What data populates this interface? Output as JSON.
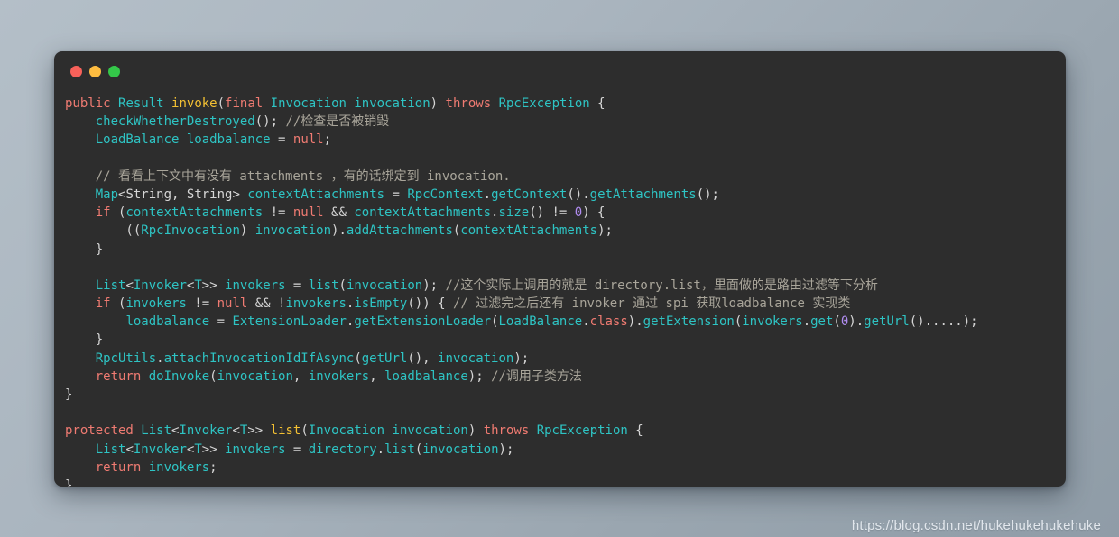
{
  "window": {
    "title": "",
    "controls": [
      {
        "name": "close-button",
        "color": "#f8615a"
      },
      {
        "name": "minimize-button",
        "color": "#fdbc40"
      },
      {
        "name": "maximize-button",
        "color": "#34c749"
      }
    ]
  },
  "theme": {
    "background_gradient_start": "#b4bfc8",
    "background_gradient_end": "#8f9ca7",
    "editor_background": "#2d2d2d",
    "keyword": "#f07b72",
    "type": "#2ec4c4",
    "function_declaration": "#f3c033",
    "punctuation": "#d6d6d6",
    "number": "#b08cf0",
    "comment": "#a9a59a"
  },
  "watermark": {
    "text": "https://blog.csdn.net/hukehukehukehuke"
  },
  "code": {
    "language": "java",
    "lines": [
      "public Result invoke(final Invocation invocation) throws RpcException {",
      "    checkWhetherDestroyed(); //检查是否被销毁",
      "    LoadBalance loadbalance = null;",
      "",
      "    // 看看上下文中有没有 attachments ，有的话绑定到 invocation.",
      "    Map<String, String> contextAttachments = RpcContext.getContext().getAttachments();",
      "    if (contextAttachments != null && contextAttachments.size() != 0) {",
      "        ((RpcInvocation) invocation).addAttachments(contextAttachments);",
      "    }",
      "",
      "    List<Invoker<T>> invokers = list(invocation); //这个实际上调用的就是 directory.list，里面做的是路由过滤等下分析",
      "    if (invokers != null && !invokers.isEmpty()) { // 过滤完之后还有 invoker 通过 spi 获取loadbalance 实现类",
      "        loadbalance = ExtensionLoader.getExtensionLoader(LoadBalance.class).getExtension(invokers.get(0).getUrl().....);",
      "    }",
      "    RpcUtils.attachInvocationIdIfAsync(getUrl(), invocation);",
      "    return doInvoke(invocation, invokers, loadbalance); //调用子类方法",
      "}",
      "",
      "protected List<Invoker<T>> list(Invocation invocation) throws RpcException {",
      "    List<Invoker<T>> invokers = directory.list(invocation);",
      "    return invokers;",
      "}"
    ],
    "tokens": [
      [
        [
          "public",
          "kw"
        ],
        [
          " ",
          "pun"
        ],
        [
          "Result",
          "typ"
        ],
        [
          " ",
          "pun"
        ],
        [
          "invoke",
          "fn"
        ],
        [
          "(",
          "pun"
        ],
        [
          "final",
          "kw"
        ],
        [
          " ",
          "pun"
        ],
        [
          "Invocation",
          "typ"
        ],
        [
          " ",
          "pun"
        ],
        [
          "invocation",
          "typ"
        ],
        [
          ")",
          "pun"
        ],
        [
          " ",
          "pun"
        ],
        [
          "throws",
          "kw"
        ],
        [
          " ",
          "pun"
        ],
        [
          "RpcException",
          "typ"
        ],
        [
          " {",
          "pun"
        ]
      ],
      [
        [
          "    ",
          "pun"
        ],
        [
          "checkWhetherDestroyed",
          "call"
        ],
        [
          "(); ",
          "pun"
        ],
        [
          "//检查是否被销毁",
          "cmt"
        ]
      ],
      [
        [
          "    ",
          "pun"
        ],
        [
          "LoadBalance",
          "typ"
        ],
        [
          " ",
          "pun"
        ],
        [
          "loadbalance",
          "typ"
        ],
        [
          " = ",
          "pun"
        ],
        [
          "null",
          "kw"
        ],
        [
          ";",
          "pun"
        ]
      ],
      [
        [
          "",
          "pun"
        ]
      ],
      [
        [
          "    ",
          "pun"
        ],
        [
          "// 看看上下文中有没有 attachments ，有的话绑定到 invocation.",
          "cmt"
        ]
      ],
      [
        [
          "    ",
          "pun"
        ],
        [
          "Map",
          "typ"
        ],
        [
          "<",
          "pun"
        ],
        [
          "String",
          "pun"
        ],
        [
          ", ",
          "pun"
        ],
        [
          "String",
          "pun"
        ],
        [
          "> ",
          "pun"
        ],
        [
          "contextAttachments",
          "typ"
        ],
        [
          " = ",
          "pun"
        ],
        [
          "RpcContext",
          "typ"
        ],
        [
          ".",
          "pun"
        ],
        [
          "getContext",
          "call"
        ],
        [
          "().",
          "pun"
        ],
        [
          "getAttachments",
          "call"
        ],
        [
          "();",
          "pun"
        ]
      ],
      [
        [
          "    ",
          "pun"
        ],
        [
          "if",
          "kw"
        ],
        [
          " (",
          "pun"
        ],
        [
          "contextAttachments",
          "typ"
        ],
        [
          " != ",
          "pun"
        ],
        [
          "null",
          "kw"
        ],
        [
          " && ",
          "pun"
        ],
        [
          "contextAttachments",
          "typ"
        ],
        [
          ".",
          "pun"
        ],
        [
          "size",
          "call"
        ],
        [
          "() != ",
          "pun"
        ],
        [
          "0",
          "num"
        ],
        [
          ") {",
          "pun"
        ]
      ],
      [
        [
          "        ((",
          "pun"
        ],
        [
          "RpcInvocation",
          "typ"
        ],
        [
          ") ",
          "pun"
        ],
        [
          "invocation",
          "typ"
        ],
        [
          ").",
          "pun"
        ],
        [
          "addAttachments",
          "call"
        ],
        [
          "(",
          "pun"
        ],
        [
          "contextAttachments",
          "typ"
        ],
        [
          ");",
          "pun"
        ]
      ],
      [
        [
          "    }",
          "pun"
        ]
      ],
      [
        [
          "",
          "pun"
        ]
      ],
      [
        [
          "    ",
          "pun"
        ],
        [
          "List",
          "typ"
        ],
        [
          "<",
          "pun"
        ],
        [
          "Invoker",
          "typ"
        ],
        [
          "<",
          "pun"
        ],
        [
          "T",
          "typ"
        ],
        [
          ">> ",
          "pun"
        ],
        [
          "invokers",
          "typ"
        ],
        [
          " = ",
          "pun"
        ],
        [
          "list",
          "call"
        ],
        [
          "(",
          "pun"
        ],
        [
          "invocation",
          "typ"
        ],
        [
          "); ",
          "pun"
        ],
        [
          "//这个实际上调用的就是 directory.list，里面做的是路由过滤等下分析",
          "cmt"
        ]
      ],
      [
        [
          "    ",
          "pun"
        ],
        [
          "if",
          "kw"
        ],
        [
          " (",
          "pun"
        ],
        [
          "invokers",
          "typ"
        ],
        [
          " != ",
          "pun"
        ],
        [
          "null",
          "kw"
        ],
        [
          " && !",
          "pun"
        ],
        [
          "invokers",
          "typ"
        ],
        [
          ".",
          "pun"
        ],
        [
          "isEmpty",
          "call"
        ],
        [
          "()) { ",
          "pun"
        ],
        [
          "// 过滤完之后还有 invoker 通过 spi 获取loadbalance 实现类",
          "cmt"
        ]
      ],
      [
        [
          "        ",
          "pun"
        ],
        [
          "loadbalance",
          "typ"
        ],
        [
          " = ",
          "pun"
        ],
        [
          "ExtensionLoader",
          "typ"
        ],
        [
          ".",
          "pun"
        ],
        [
          "getExtensionLoader",
          "call"
        ],
        [
          "(",
          "pun"
        ],
        [
          "LoadBalance",
          "typ"
        ],
        [
          ".",
          "pun"
        ],
        [
          "class",
          "kw"
        ],
        [
          ").",
          "pun"
        ],
        [
          "getExtension",
          "call"
        ],
        [
          "(",
          "pun"
        ],
        [
          "invokers",
          "typ"
        ],
        [
          ".",
          "pun"
        ],
        [
          "get",
          "call"
        ],
        [
          "(",
          "pun"
        ],
        [
          "0",
          "num"
        ],
        [
          ").",
          "pun"
        ],
        [
          "getUrl",
          "call"
        ],
        [
          "().....);",
          "pun"
        ]
      ],
      [
        [
          "    }",
          "pun"
        ]
      ],
      [
        [
          "    ",
          "pun"
        ],
        [
          "RpcUtils",
          "typ"
        ],
        [
          ".",
          "pun"
        ],
        [
          "attachInvocationIdIfAsync",
          "call"
        ],
        [
          "(",
          "pun"
        ],
        [
          "getUrl",
          "call"
        ],
        [
          "(), ",
          "pun"
        ],
        [
          "invocation",
          "typ"
        ],
        [
          ");",
          "pun"
        ]
      ],
      [
        [
          "    ",
          "pun"
        ],
        [
          "return",
          "kw"
        ],
        [
          " ",
          "pun"
        ],
        [
          "doInvoke",
          "call"
        ],
        [
          "(",
          "pun"
        ],
        [
          "invocation",
          "typ"
        ],
        [
          ", ",
          "pun"
        ],
        [
          "invokers",
          "typ"
        ],
        [
          ", ",
          "pun"
        ],
        [
          "loadbalance",
          "typ"
        ],
        [
          "); ",
          "pun"
        ],
        [
          "//调用子类方法",
          "cmt"
        ]
      ],
      [
        [
          "}",
          "pun"
        ]
      ],
      [
        [
          "",
          "pun"
        ]
      ],
      [
        [
          "protected",
          "kw"
        ],
        [
          " ",
          "pun"
        ],
        [
          "List",
          "typ"
        ],
        [
          "<",
          "pun"
        ],
        [
          "Invoker",
          "typ"
        ],
        [
          "<",
          "pun"
        ],
        [
          "T",
          "typ"
        ],
        [
          ">> ",
          "pun"
        ],
        [
          "list",
          "fn"
        ],
        [
          "(",
          "pun"
        ],
        [
          "Invocation",
          "typ"
        ],
        [
          " ",
          "pun"
        ],
        [
          "invocation",
          "typ"
        ],
        [
          ") ",
          "pun"
        ],
        [
          "throws",
          "kw"
        ],
        [
          " ",
          "pun"
        ],
        [
          "RpcException",
          "typ"
        ],
        [
          " {",
          "pun"
        ]
      ],
      [
        [
          "    ",
          "pun"
        ],
        [
          "List",
          "typ"
        ],
        [
          "<",
          "pun"
        ],
        [
          "Invoker",
          "typ"
        ],
        [
          "<",
          "pun"
        ],
        [
          "T",
          "typ"
        ],
        [
          ">> ",
          "pun"
        ],
        [
          "invokers",
          "typ"
        ],
        [
          " = ",
          "pun"
        ],
        [
          "directory",
          "typ"
        ],
        [
          ".",
          "pun"
        ],
        [
          "list",
          "call"
        ],
        [
          "(",
          "pun"
        ],
        [
          "invocation",
          "typ"
        ],
        [
          ");",
          "pun"
        ]
      ],
      [
        [
          "    ",
          "pun"
        ],
        [
          "return",
          "kw"
        ],
        [
          " ",
          "pun"
        ],
        [
          "invokers",
          "typ"
        ],
        [
          ";",
          "pun"
        ]
      ],
      [
        [
          "}",
          "pun"
        ]
      ]
    ]
  }
}
